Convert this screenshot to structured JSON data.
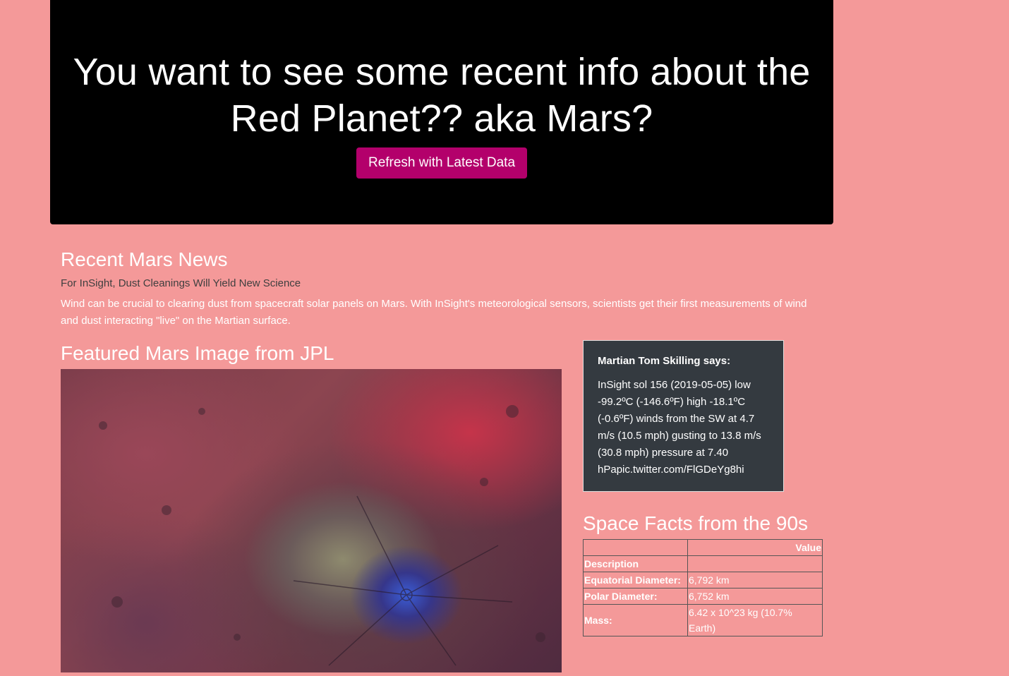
{
  "hero": {
    "title": "You want to see some recent info about the Red Planet?? aka Mars?",
    "button_label": "Refresh with Latest Data"
  },
  "news": {
    "heading": "Recent Mars News",
    "title": "For InSight, Dust Cleanings Will Yield New Science",
    "text": "Wind can be crucial to clearing dust from spacecraft solar panels on Mars. With InSight's meteorological sensors, scientists get their first measurements of wind and dust interacting \"live\" on the Martian surface."
  },
  "featured": {
    "heading": "Featured Mars Image from JPL"
  },
  "weather": {
    "title": "Martian Tom Skilling says:",
    "text": "InSight sol 156 (2019-05-05) low -99.2ºC (-146.6ºF) high -18.1ºC (-0.6ºF) winds from the SW at 4.7 m/s (10.5 mph) gusting to 13.8 m/s (30.8 mph) pressure at 7.40 hPapic.twitter.com/FlGDeYg8hi"
  },
  "facts": {
    "heading": "Space Facts from the 90s",
    "column_header": "Value",
    "index_header": "Description",
    "rows": [
      {
        "label": "Equatorial Diameter:",
        "value": "6,792 km"
      },
      {
        "label": "Polar Diameter:",
        "value": "6,752 km"
      },
      {
        "label": "Mass:",
        "value": "6.42 x 10^23 kg (10.7% Earth)"
      }
    ]
  }
}
